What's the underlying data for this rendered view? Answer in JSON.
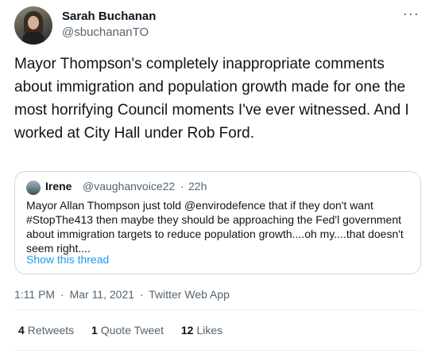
{
  "author": {
    "name": "Sarah Buchanan",
    "handle": "@sbuchananTO"
  },
  "more_glyph": "···",
  "tweet": {
    "text": "Mayor Thompson's completely inappropriate comments about immigration and population growth made for one the most horrifying Council moments I've ever witnessed. And I worked at City Hall under Rob Ford."
  },
  "quote": {
    "name": "Irene",
    "handle": "@vaughanvoice22",
    "separator": "·",
    "time": "22h",
    "text": "Mayor Allan Thompson just told @envirodefence that if they don't want #StopThe413 then maybe they should be approaching the Fed'l government about immigration targets to reduce population growth....oh my....that doesn't seem right....",
    "show_thread": "Show this thread"
  },
  "meta": {
    "time": "1:11 PM",
    "sep1": "·",
    "date": "Mar 11, 2021",
    "sep2": "·",
    "source": "Twitter Web App"
  },
  "stats": {
    "retweets_count": "4",
    "retweets_label": "Retweets",
    "quotes_count": "1",
    "quotes_label": "Quote Tweet",
    "likes_count": "12",
    "likes_label": "Likes"
  }
}
